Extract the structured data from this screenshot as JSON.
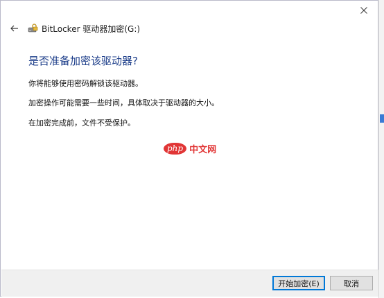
{
  "window": {
    "title": "BitLocker 驱动器加密(G:)"
  },
  "icons": {
    "close": "close-icon",
    "back": "back-arrow-icon",
    "app": "bitlocker-drive-icon"
  },
  "content": {
    "heading": "是否准备加密该驱动器?",
    "paragraphs": [
      "你将能够使用密码解锁该驱动器。",
      "加密操作可能需要一些时间，具体取决于驱动器的大小。",
      "在加密完成前，文件不受保护。"
    ]
  },
  "watermark": {
    "badge": "php",
    "text": "中文网"
  },
  "footer": {
    "start_label": "开始加密(E)",
    "cancel_label": "取消"
  },
  "colors": {
    "heading": "#1d3e8a",
    "primary_border": "#0078d7",
    "watermark": "#e02c2c"
  }
}
